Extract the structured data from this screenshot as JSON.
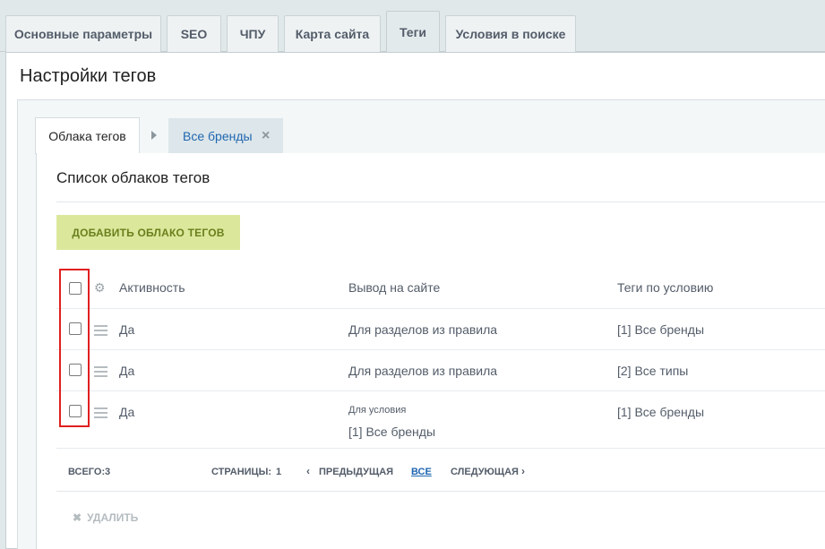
{
  "top_tabs": [
    {
      "label": "Основные параметры"
    },
    {
      "label": "SEO"
    },
    {
      "label": "ЧПУ"
    },
    {
      "label": "Карта сайта"
    },
    {
      "label": "Теги"
    },
    {
      "label": "Условия в поиске"
    }
  ],
  "active_top_tab": "Теги",
  "page_title": "Настройки тегов",
  "sub_tabs": {
    "active": "Облака тегов",
    "closable": "Все бренды",
    "close_icon": "×"
  },
  "section_title": "Список облаков тегов",
  "add_button": "ДОБАВИТЬ ОБЛАКО ТЕГОВ",
  "table": {
    "headers": {
      "activity": "Активность",
      "output": "Вывод на сайте",
      "tags": "Теги по условию"
    },
    "rows": [
      {
        "activity": "Да",
        "output": "Для разделов из правила",
        "output_sub": "",
        "tags": "[1] Все бренды"
      },
      {
        "activity": "Да",
        "output": "Для разделов из правила",
        "output_sub": "",
        "tags": "[2] Все типы"
      },
      {
        "activity": "Да",
        "output_small": "Для условия",
        "output": "[1] Все бренды",
        "tags": "[1] Все бренды"
      }
    ]
  },
  "footer": {
    "total_label": "ВСЕГО:",
    "total_value": "3",
    "pages_label": "СТРАНИЦЫ:",
    "pages_value": "1",
    "prev": "ПРЕДЫДУЩАЯ",
    "all": "ВСЕ",
    "next": "СЛЕДУЮЩАЯ"
  },
  "delete_button": "УДАЛИТЬ",
  "highlight_color": "#e02020"
}
